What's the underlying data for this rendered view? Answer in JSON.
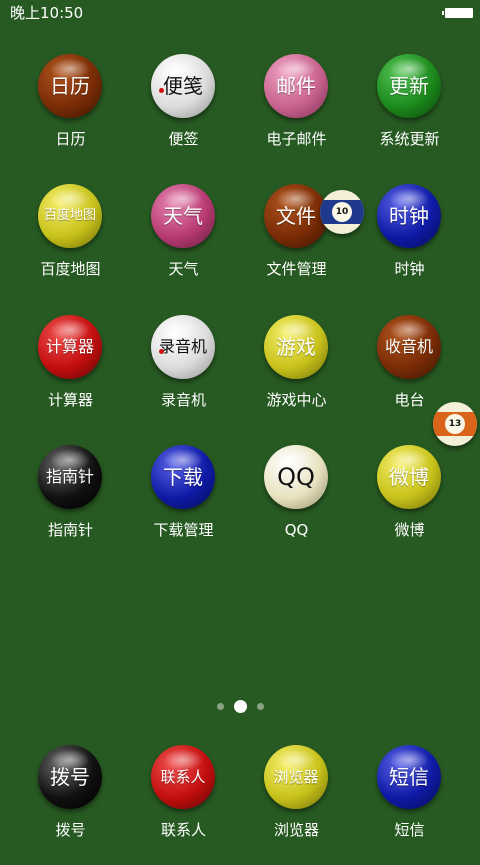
{
  "status_bar": {
    "time": "晚上10:50",
    "battery_icon": "battery-full-icon"
  },
  "apps": [
    {
      "ball_text": "日历",
      "label": "日历",
      "color": "#7a2c06"
    },
    {
      "ball_text": "便笺",
      "label": "便签",
      "color": "#e6e6e6"
    },
    {
      "ball_text": "邮件",
      "label": "电子邮件",
      "color": "#c8638f"
    },
    {
      "ball_text": "更新",
      "label": "系统更新",
      "color": "#1c8a1c"
    },
    {
      "ball_text": "百度地图",
      "label": "百度地图",
      "color": "#c8c21b"
    },
    {
      "ball_text": "天气",
      "label": "天气",
      "color": "#b83a73"
    },
    {
      "ball_text": "文件",
      "label": "文件管理",
      "color": "#7a2c06"
    },
    {
      "ball_text": "时钟",
      "label": "时钟",
      "color": "#0f1aa6"
    },
    {
      "ball_text": "计算器",
      "label": "计算器",
      "color": "#c30e0e"
    },
    {
      "ball_text": "录音机",
      "label": "录音机",
      "color": "#e6e6e6"
    },
    {
      "ball_text": "游戏",
      "label": "游戏中心",
      "color": "#c8c21b"
    },
    {
      "ball_text": "收音机",
      "label": "电台",
      "color": "#7a2c06"
    },
    {
      "ball_text": "指南针",
      "label": "指南针",
      "color": "#101010"
    },
    {
      "ball_text": "下载",
      "label": "下载管理",
      "color": "#0f1aa6"
    },
    {
      "ball_text": "QQ",
      "label": "QQ",
      "color": "#e8e2c0"
    },
    {
      "ball_text": "微博",
      "label": "微博",
      "color": "#c8c21b"
    }
  ],
  "dock": [
    {
      "ball_text": "拨号",
      "label": "拨号",
      "color": "#101010"
    },
    {
      "ball_text": "联系人",
      "label": "联系人",
      "color": "#c30e0e"
    },
    {
      "ball_text": "浏览器",
      "label": "浏览器",
      "color": "#c8c21b"
    },
    {
      "ball_text": "短信",
      "label": "短信",
      "color": "#0f1aa6"
    }
  ],
  "decorations": [
    {
      "number": "10",
      "stripe_color": "#1f3a8c"
    },
    {
      "number": "13",
      "stripe_color": "#d9641a"
    }
  ],
  "page_indicator": {
    "count": 3,
    "active": 2
  }
}
